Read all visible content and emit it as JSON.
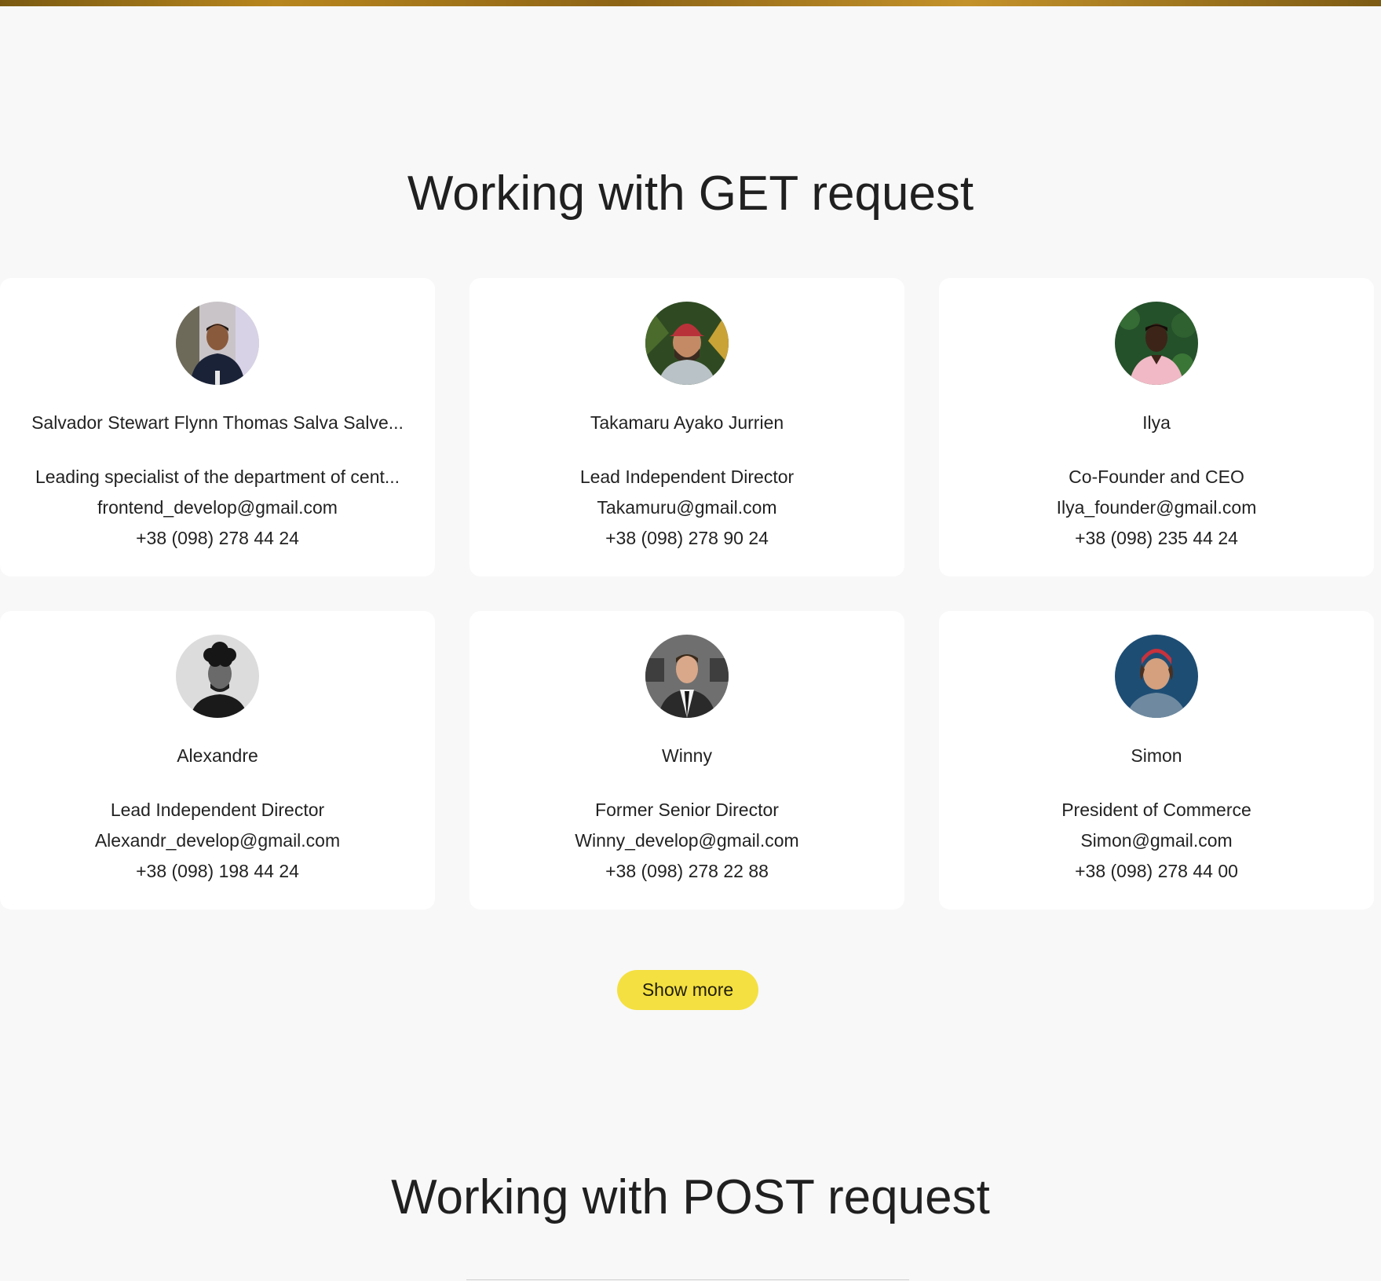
{
  "get_section": {
    "title": "Working with GET request",
    "show_more_label": "Show more"
  },
  "post_section": {
    "title": "Working with POST request"
  },
  "users": [
    {
      "name": "Salvador Stewart Flynn Thomas Salva Salve...",
      "position": "Leading specialist of the department of cent...",
      "email": "frontend_develop@gmail.com",
      "phone": "+38 (098) 278 44 24"
    },
    {
      "name": "Takamaru Ayako Jurrien",
      "position": "Lead Independent Director",
      "email": "Takamuru@gmail.com",
      "phone": "+38 (098) 278 90 24"
    },
    {
      "name": "Ilya",
      "position": "Co-Founder and CEO",
      "email": "Ilya_founder@gmail.com",
      "phone": "+38 (098) 235 44 24"
    },
    {
      "name": "Alexandre",
      "position": "Lead Independent Director",
      "email": "Alexandr_develop@gmail.com",
      "phone": "+38 (098) 198 44 24"
    },
    {
      "name": "Winny",
      "position": "Former Senior Director",
      "email": "Winny_develop@gmail.com",
      "phone": "+38 (098) 278 22 88"
    },
    {
      "name": "Simon",
      "position": "President of Commerce",
      "email": "Simon@gmail.com",
      "phone": "+38 (098) 278 44 00"
    }
  ],
  "colors": {
    "background": "#f8f8f8",
    "card": "#ffffff",
    "accent_button": "#f4e041"
  }
}
